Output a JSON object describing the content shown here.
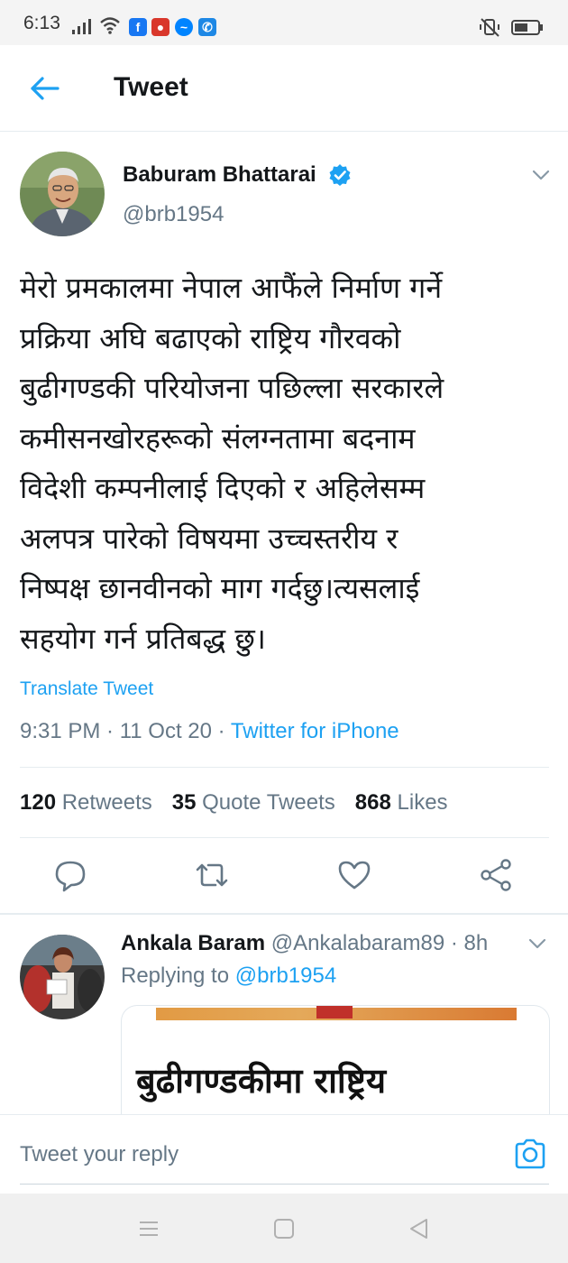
{
  "status_bar": {
    "time": "6:13",
    "app_icons": [
      {
        "name": "facebook-icon",
        "color": "#1877f2",
        "glyph": "f"
      },
      {
        "name": "app-icon",
        "color": "#d9372b",
        "glyph": "●"
      },
      {
        "name": "messenger-icon",
        "color": "#0084ff",
        "glyph": "~"
      },
      {
        "name": "phone-app-icon",
        "color": "#1e88e5",
        "glyph": "✆"
      }
    ]
  },
  "header": {
    "title": "Tweet"
  },
  "tweet": {
    "author_name": "Baburam Bhattarai",
    "handle": "@brb1954",
    "text": "मेरो प्रमकालमा नेपाल आफैंले निर्माण गर्ने प्रक्रिया अघि बढाएको राष्ट्रिय गौरवको बुढीगण्डकी परियोजना पछिल्ला सरकारले कमीसनखोरहरूको संलग्नतामा बदनाम विदेशी कम्पनीलाई दिएको र अहिलेसम्म अलपत्र पारेको विषयमा उच्चस्तरीय र निष्पक्ष छानवीनको माग गर्दछु।त्यसलाई सहयोग गर्न प्रतिबद्ध छु।",
    "text_lines": [
      "मेरो प्रमकालमा नेपाल आफैंले निर्माण गर्ने",
      "प्रक्रिया अघि बढाएको राष्ट्रिय गौरवको",
      "बुढीगण्डकी परियोजना पछिल्ला सरकारले",
      "कमीसनखोरहरूको संलग्नतामा बदनाम",
      "विदेशी कम्पनीलाई दिएको र अहिलेसम्म",
      "अलपत्र पारेको विषयमा उच्चस्तरीय र",
      "निष्पक्ष छानवीनको माग गर्दछु।त्यसलाई",
      "सहयोग गर्न प्रतिबद्ध छु।"
    ],
    "translate_label": "Translate Tweet",
    "time": "9:31 PM",
    "date": "11 Oct 20",
    "source": "Twitter for iPhone",
    "separator": " · ",
    "stats": {
      "retweets_count": "120",
      "retweets_label": "Retweets",
      "quotes_count": "35",
      "quotes_label": "Quote Tweets",
      "likes_count": "868",
      "likes_label": "Likes"
    },
    "actions": [
      "reply-icon",
      "retweet-icon",
      "like-icon",
      "share-icon"
    ],
    "accent_color": "#1da1f2",
    "verified_color": "#1da1f2"
  },
  "reply": {
    "author_name": "Ankala Baram",
    "handle": "@Ankalabaram89",
    "time": "8h",
    "replying_prefix": "Replying to",
    "replying_to": "@brb1954",
    "media_headline": "बुढीगण्डकीमा राष्ट्रिय"
  },
  "composer": {
    "placeholder": "Tweet your reply"
  }
}
